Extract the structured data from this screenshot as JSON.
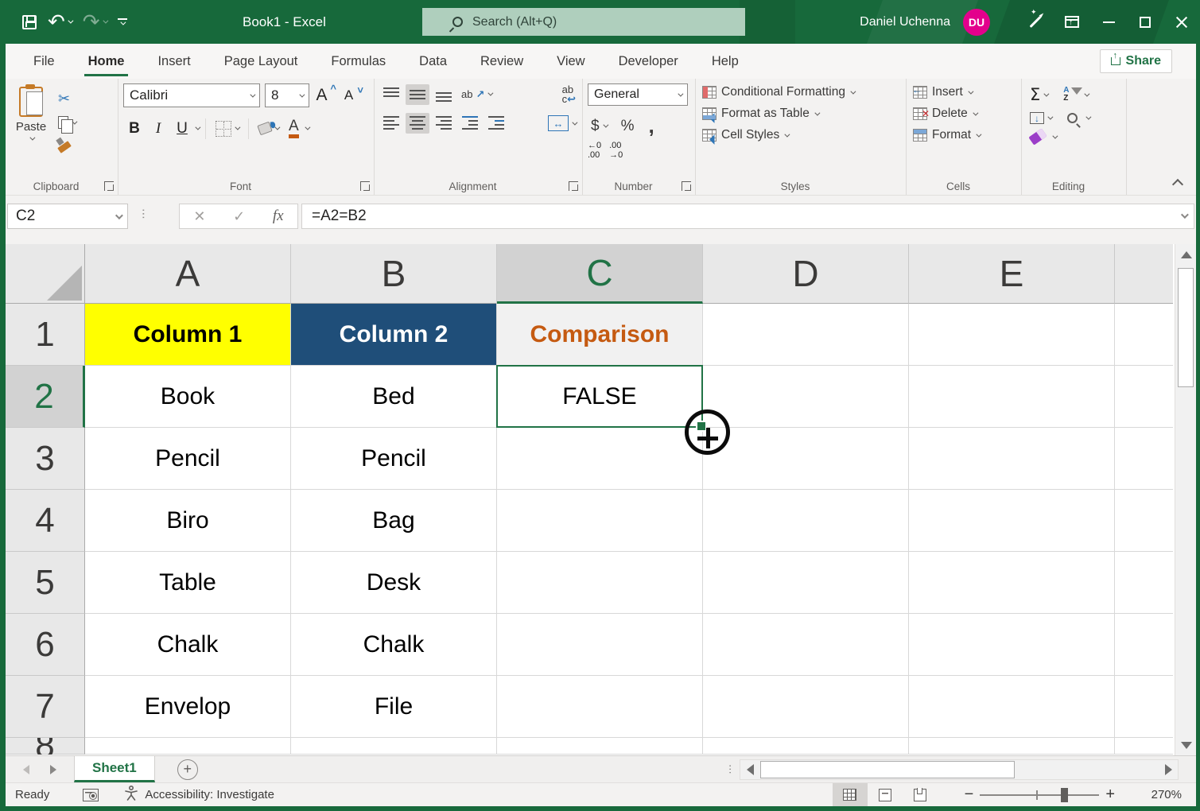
{
  "titlebar": {
    "title": "Book1 - Excel",
    "search_placeholder": "Search (Alt+Q)",
    "user_name": "Daniel Uchenna",
    "user_initials": "DU"
  },
  "ribbon": {
    "tabs": [
      "File",
      "Home",
      "Insert",
      "Page Layout",
      "Formulas",
      "Data",
      "Review",
      "View",
      "Developer",
      "Help"
    ],
    "active_tab": "Home",
    "share_label": "Share",
    "clipboard": {
      "label": "Clipboard",
      "paste_label": "Paste"
    },
    "font": {
      "label": "Font",
      "font_name": "Calibri",
      "font_size": "8",
      "bold": "B",
      "italic": "I",
      "underline": "U",
      "grow": "A",
      "shrink": "A",
      "color_letter": "A"
    },
    "alignment": {
      "label": "Alignment",
      "orientation_glyph": "ab",
      "wrap_line1": "ab",
      "wrap_line2": "c"
    },
    "number": {
      "label": "Number",
      "format": "General",
      "currency": "$",
      "percent": "%",
      "comma": ",",
      "inc_decimal": "←0\n.00",
      "dec_decimal": ".00\n→0"
    },
    "styles": {
      "label": "Styles",
      "items": [
        "Conditional Formatting",
        "Format as Table",
        "Cell Styles"
      ]
    },
    "cells": {
      "label": "Cells",
      "items": [
        "Insert",
        "Delete",
        "Format"
      ]
    },
    "editing": {
      "label": "Editing",
      "autosum": "Σ",
      "sort_a": "A",
      "sort_z": "Z"
    }
  },
  "formula_bar": {
    "name_box": "C2",
    "formula": "=A2=B2",
    "fx": "fx",
    "cancel": "✕",
    "enter": "✓"
  },
  "grid": {
    "columns": [
      "A",
      "B",
      "C",
      "D",
      "E"
    ],
    "selected_column": "C",
    "selected_cell": "C2",
    "rows": [
      {
        "num": "1",
        "cells": [
          {
            "v": "Column 1",
            "bg": "#FFFF00",
            "fg": "#000000",
            "bold": true
          },
          {
            "v": "Column 2",
            "bg": "#1F4E79",
            "fg": "#FFFFFF",
            "bold": true
          },
          {
            "v": "Comparison",
            "bg": "#F1F1F1",
            "fg": "#C55A11",
            "bold": true
          },
          {},
          {}
        ]
      },
      {
        "num": "2",
        "selected": true,
        "cells": [
          {
            "v": "Book"
          },
          {
            "v": "Bed"
          },
          {
            "v": "FALSE",
            "sel": true
          },
          {},
          {}
        ]
      },
      {
        "num": "3",
        "cells": [
          {
            "v": "Pencil"
          },
          {
            "v": "Pencil"
          },
          {},
          {},
          {}
        ]
      },
      {
        "num": "4",
        "cells": [
          {
            "v": "Biro"
          },
          {
            "v": "Bag"
          },
          {},
          {},
          {}
        ]
      },
      {
        "num": "5",
        "cells": [
          {
            "v": "Table"
          },
          {
            "v": "Desk"
          },
          {},
          {},
          {}
        ]
      },
      {
        "num": "6",
        "cells": [
          {
            "v": "Chalk"
          },
          {
            "v": "Chalk"
          },
          {},
          {},
          {}
        ]
      },
      {
        "num": "7",
        "cells": [
          {
            "v": "Envelop"
          },
          {
            "v": "File"
          },
          {},
          {},
          {}
        ]
      },
      {
        "num": "8",
        "partial": true,
        "cells": [
          {},
          {},
          {},
          {},
          {}
        ]
      }
    ]
  },
  "sheet_bar": {
    "sheet_name": "Sheet1"
  },
  "status_bar": {
    "mode": "Ready",
    "accessibility": "Accessibility: Investigate",
    "zoom_level": "270%"
  },
  "colors": {
    "excel_green": "#217346",
    "titlebar_green": "#17693B",
    "header_yellow": "#FFFF00",
    "header_dark_blue": "#1F4E79",
    "comparison_orange": "#C55A11",
    "avatar_pink": "#E3008C"
  }
}
